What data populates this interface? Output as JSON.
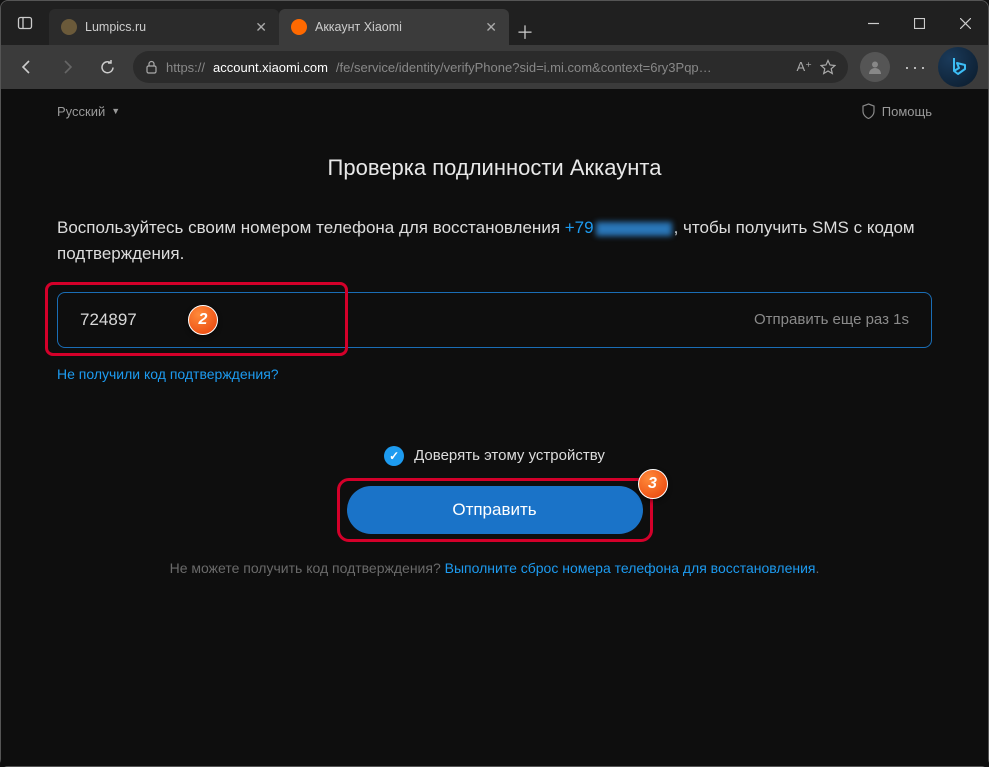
{
  "titlebar": {
    "tabs": [
      {
        "title": "Lumpics.ru",
        "favicon_color": "#6b5a3a",
        "active": false
      },
      {
        "title": "Аккаунт Xiaomi",
        "favicon_color": "#ff6900",
        "active": true
      }
    ]
  },
  "addressbar": {
    "scheme": "https://",
    "domain": "account.xiaomi.com",
    "path": "/fe/service/identity/verifyPhone?sid=i.mi.com&context=6ry3Pqp…",
    "reader_label": "A⁺"
  },
  "page": {
    "language": "Русский",
    "help": "Помощь",
    "title": "Проверка подлинности Аккаунта",
    "desc_before": "Воспользуйтесь своим номером телефона для восстановления ",
    "phone": "+79",
    "desc_after": ", чтобы получить SMS с кодом подтверждения.",
    "code_value": "724897",
    "resend": "Отправить еще раз 1s",
    "no_code_link": "Не получили код подтверждения?",
    "trust_label": "Доверять этому устройству",
    "submit": "Отправить",
    "foot_q": "Не можете получить код подтверждения? ",
    "foot_link": "Выполните сброс номера телефона для восстановления",
    "foot_dot": "."
  },
  "annotations": {
    "b2": "2",
    "b3": "3"
  }
}
